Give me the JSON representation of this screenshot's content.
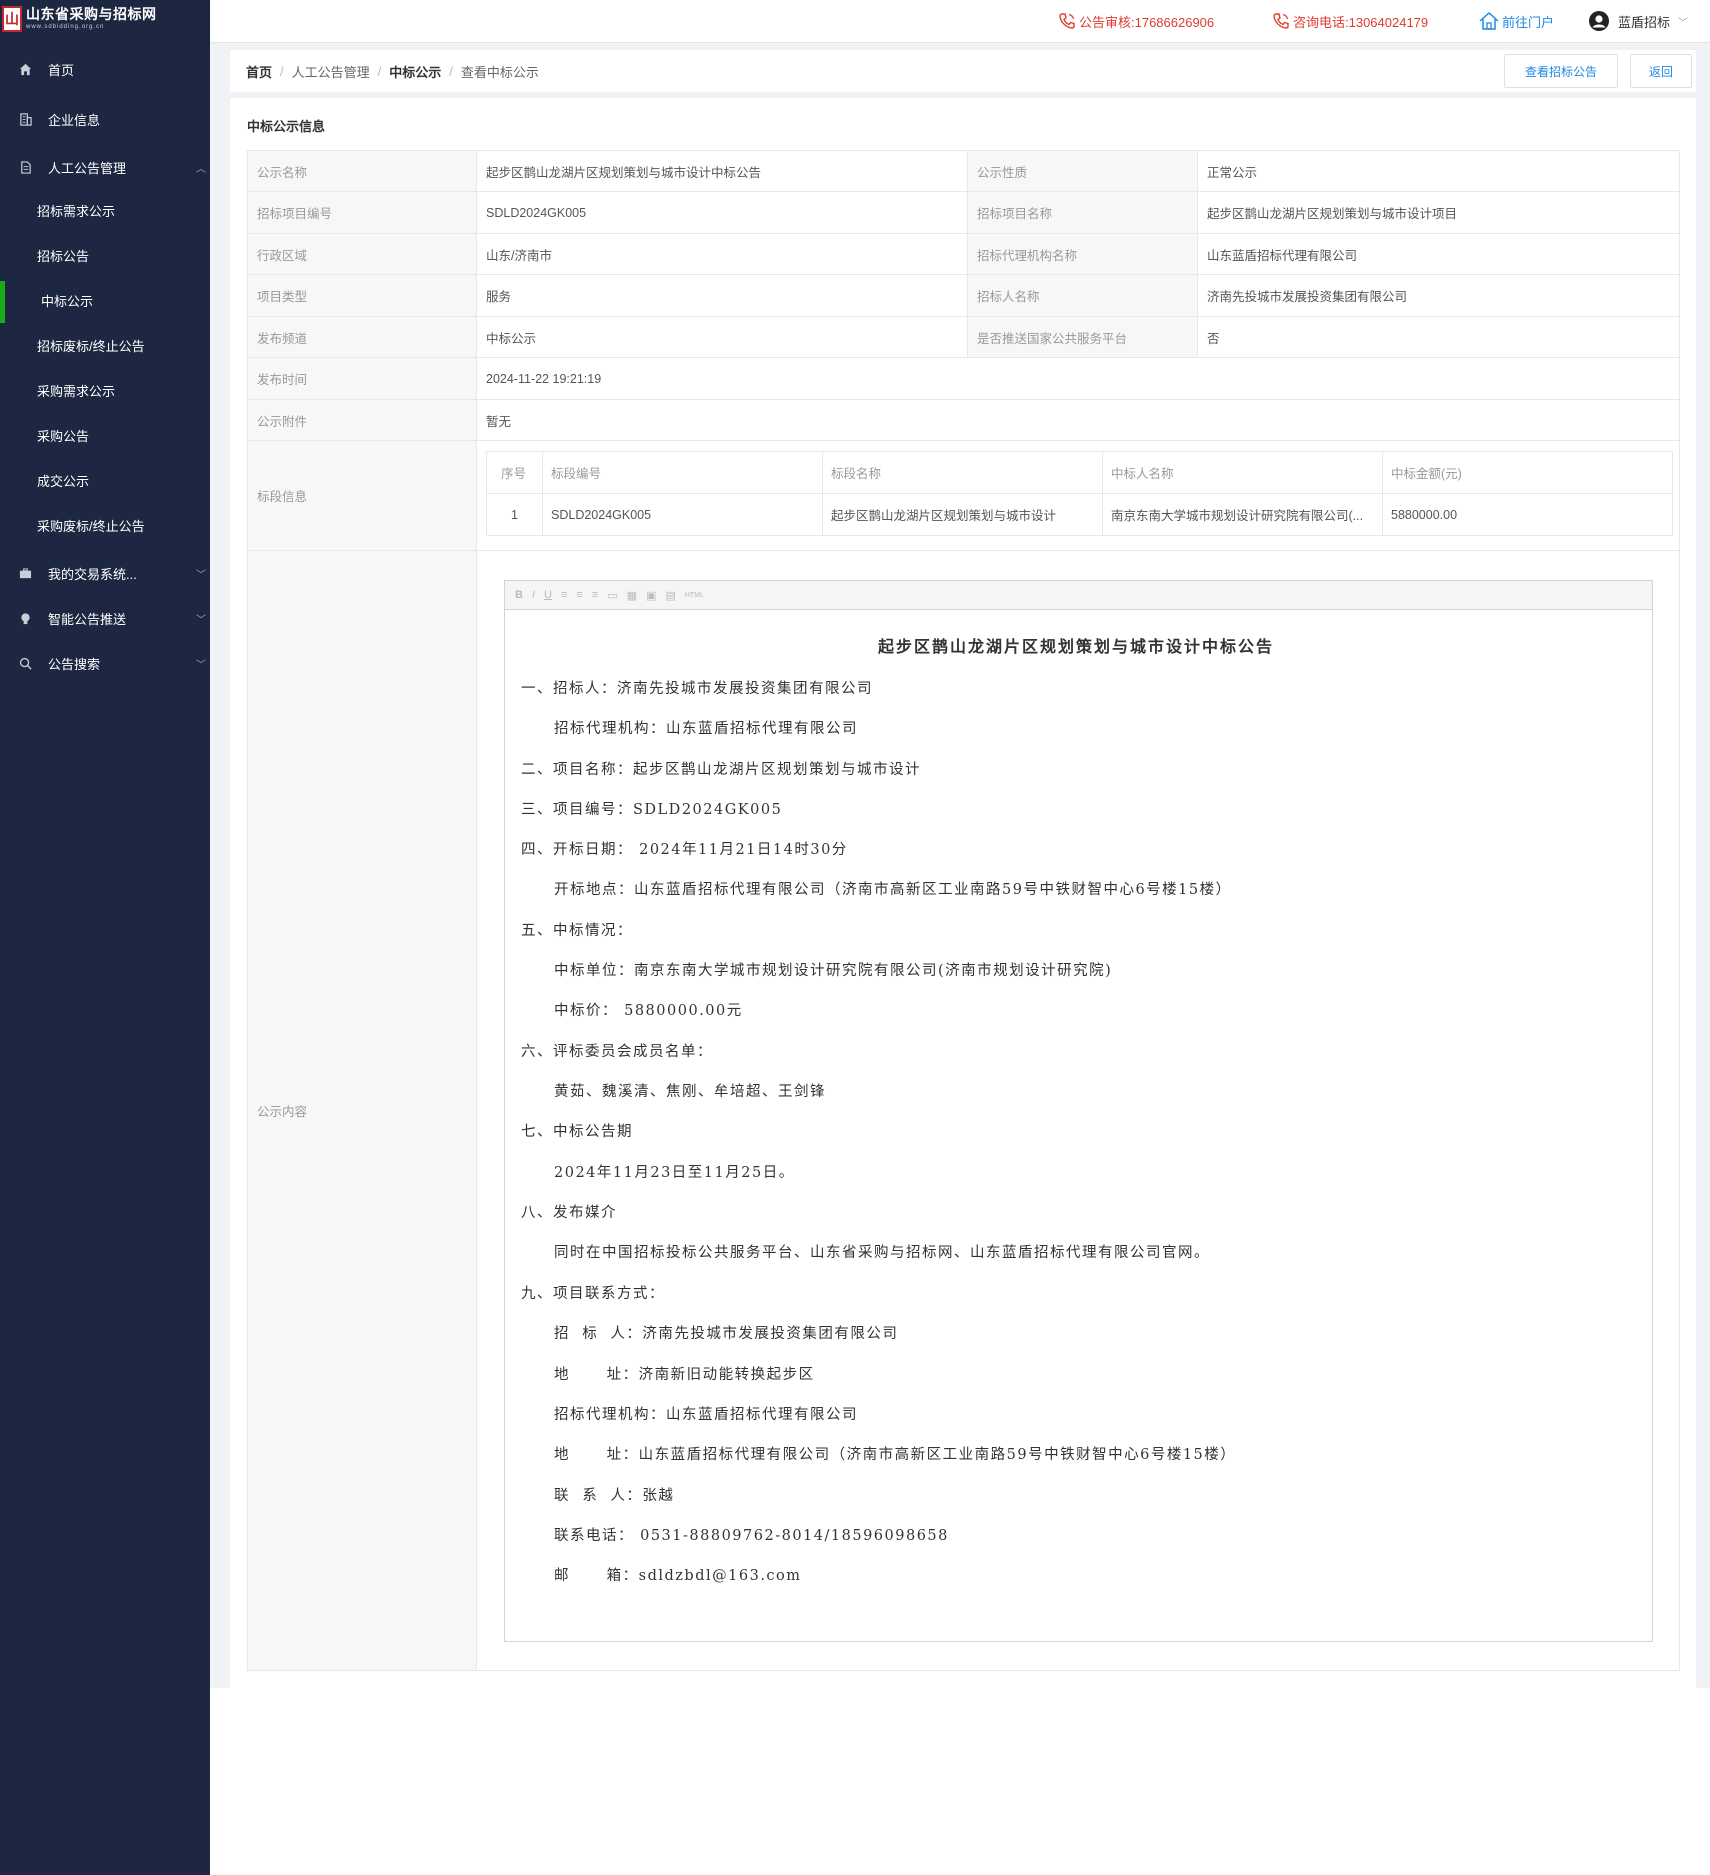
{
  "brand": {
    "name": "山东省采购与招标网",
    "url": "www.sdbidding.org.cn",
    "mark": "山"
  },
  "header": {
    "audit_label": "公告审核:17686626906",
    "consult_label": "咨询电话:13064024179",
    "portal_label": "前往门户",
    "user_label": "蓝盾招标"
  },
  "sidebar": {
    "home": "首页",
    "company": "企业信息",
    "manual": "人工公告管理",
    "sub": [
      "招标需求公示",
      "招标公告",
      "中标公示",
      "招标废标/终止公告",
      "采购需求公示",
      "采购公告",
      "成交公示",
      "采购废标/终止公告"
    ],
    "trade": "我的交易系统...",
    "push": "智能公告推送",
    "search": "公告搜索"
  },
  "breadcrumb": [
    "首页",
    "人工公告管理",
    "中标公示",
    "查看中标公示"
  ],
  "buttons": {
    "view_bid": "查看招标公告",
    "back": "返回"
  },
  "card_title": "中标公示信息",
  "fields": {
    "name_label": "公示名称",
    "name_value": "起步区鹊山龙湖片区规划策划与城市设计中标公告",
    "nature_label": "公示性质",
    "nature_value": "正常公示",
    "code_label": "招标项目编号",
    "code_value": "SDLD2024GK005",
    "proj_label": "招标项目名称",
    "proj_value": "起步区鹊山龙湖片区规划策划与城市设计项目",
    "region_label": "行政区域",
    "region_value": "山东/济南市",
    "agency_label": "招标代理机构名称",
    "agency_value": "山东蓝盾招标代理有限公司",
    "type_label": "项目类型",
    "type_value": "服务",
    "tenderer_label": "招标人名称",
    "tenderer_value": "济南先投城市发展投资集团有限公司",
    "channel_label": "发布频道",
    "channel_value": "中标公示",
    "push_label": "是否推送国家公共服务平台",
    "push_value": "否",
    "time_label": "发布时间",
    "time_value": "2024-11-22 19:21:19",
    "attach_label": "公示附件",
    "attach_value": "暂无",
    "section_label": "标段信息",
    "content_label": "公示内容"
  },
  "section_table": {
    "headers": [
      "序号",
      "标段编号",
      "标段名称",
      "中标人名称",
      "中标金额(元)"
    ],
    "rows": [
      [
        "1",
        "SDLD2024GK005",
        "起步区鹊山龙湖片区规划策划与城市设计",
        "南京东南大学城市规划设计研究院有限公司(...",
        "5880000.00"
      ]
    ]
  },
  "editor_toolbar": [
    "B",
    "I",
    "U",
    "≡",
    "≡",
    "≡",
    "▭",
    "▦",
    "▣",
    "▤",
    "HTML"
  ],
  "document": {
    "title": "起步区鹊山龙湖片区规划策划与城市设计中标公告",
    "lines": [
      "一、招标人：济南先投城市发展投资集团有限公司",
      "招标代理机构：山东蓝盾招标代理有限公司",
      "二、项目名称：起步区鹊山龙湖片区规划策划与城市设计",
      "三、项目编号：SDLD2024GK005",
      "四、开标日期： 2024年11月21日14时30分",
      "开标地点：山东蓝盾招标代理有限公司（济南市高新区工业南路59号中铁财智中心6号楼15楼）",
      "五、中标情况：",
      "中标单位：南京东南大学城市规划设计研究院有限公司(济南市规划设计研究院)",
      "中标价： 5880000.00元",
      "六、评标委员会成员名单：",
      "黄茹、魏溪清、焦刚、牟培超、王剑锋",
      "七、中标公告期",
      "2024年11月23日至11月25日。",
      "八、发布媒介",
      "同时在中国招标投标公共服务平台、山东省采购与招标网、山东蓝盾招标代理有限公司官网。",
      "九、项目联系方式：",
      "招  标  人：济南先投城市发展投资集团有限公司",
      "地      址：济南新旧动能转换起步区",
      "招标代理机构：山东蓝盾招标代理有限公司",
      "地      址：山东蓝盾招标代理有限公司（济南市高新区工业南路59号中铁财智中心6号楼15楼）",
      "联  系  人：张越",
      "联系电话： 0531-88809762-8014/18596098658",
      "邮      箱：sdldzbdl@163.com"
    ]
  }
}
